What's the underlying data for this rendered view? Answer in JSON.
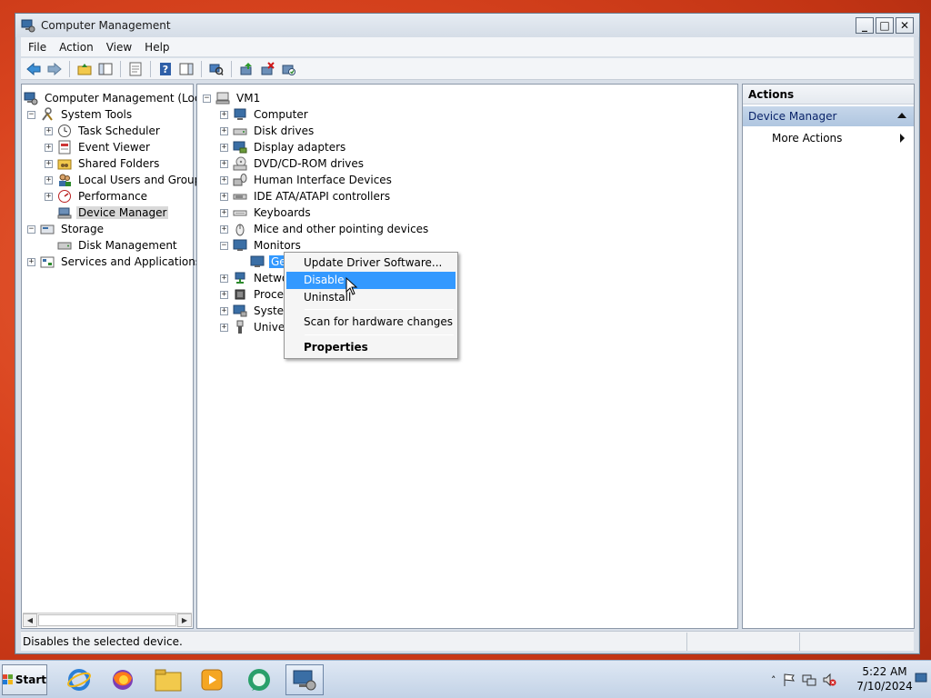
{
  "window": {
    "title": "Computer Management",
    "buttons": {
      "minimize": "_",
      "maximize": "□",
      "close": "✕"
    }
  },
  "menu": [
    "File",
    "Action",
    "View",
    "Help"
  ],
  "left_tree": {
    "root": "Computer Management (Local",
    "system_tools": "System Tools",
    "task_scheduler": "Task Scheduler",
    "event_viewer": "Event Viewer",
    "shared_folders": "Shared Folders",
    "local_users": "Local Users and Groups",
    "performance": "Performance",
    "device_manager": "Device Manager",
    "storage": "Storage",
    "disk_management": "Disk Management",
    "services": "Services and Applications"
  },
  "device_tree": {
    "root": "VM1",
    "items": [
      "Computer",
      "Disk drives",
      "Display adapters",
      "DVD/CD-ROM drives",
      "Human Interface Devices",
      "IDE ATA/ATAPI controllers",
      "Keyboards",
      "Mice and other pointing devices",
      "Monitors"
    ],
    "monitor_child": "Ge",
    "after_items": [
      "Netwo",
      "Proces",
      "System",
      "Univer"
    ]
  },
  "context_menu": {
    "update": "Update Driver Software...",
    "disable": "Disable",
    "uninstall": "Uninstall",
    "scan": "Scan for hardware changes",
    "properties": "Properties"
  },
  "actions": {
    "header": "Actions",
    "section": "Device Manager",
    "more": "More Actions"
  },
  "status": {
    "text": "Disables the selected device."
  },
  "taskbar": {
    "start": "Start",
    "time": "5:22 AM",
    "date": "7/10/2024"
  },
  "colors": {
    "selection": "#3399ff",
    "desktop": "#d9441f"
  }
}
